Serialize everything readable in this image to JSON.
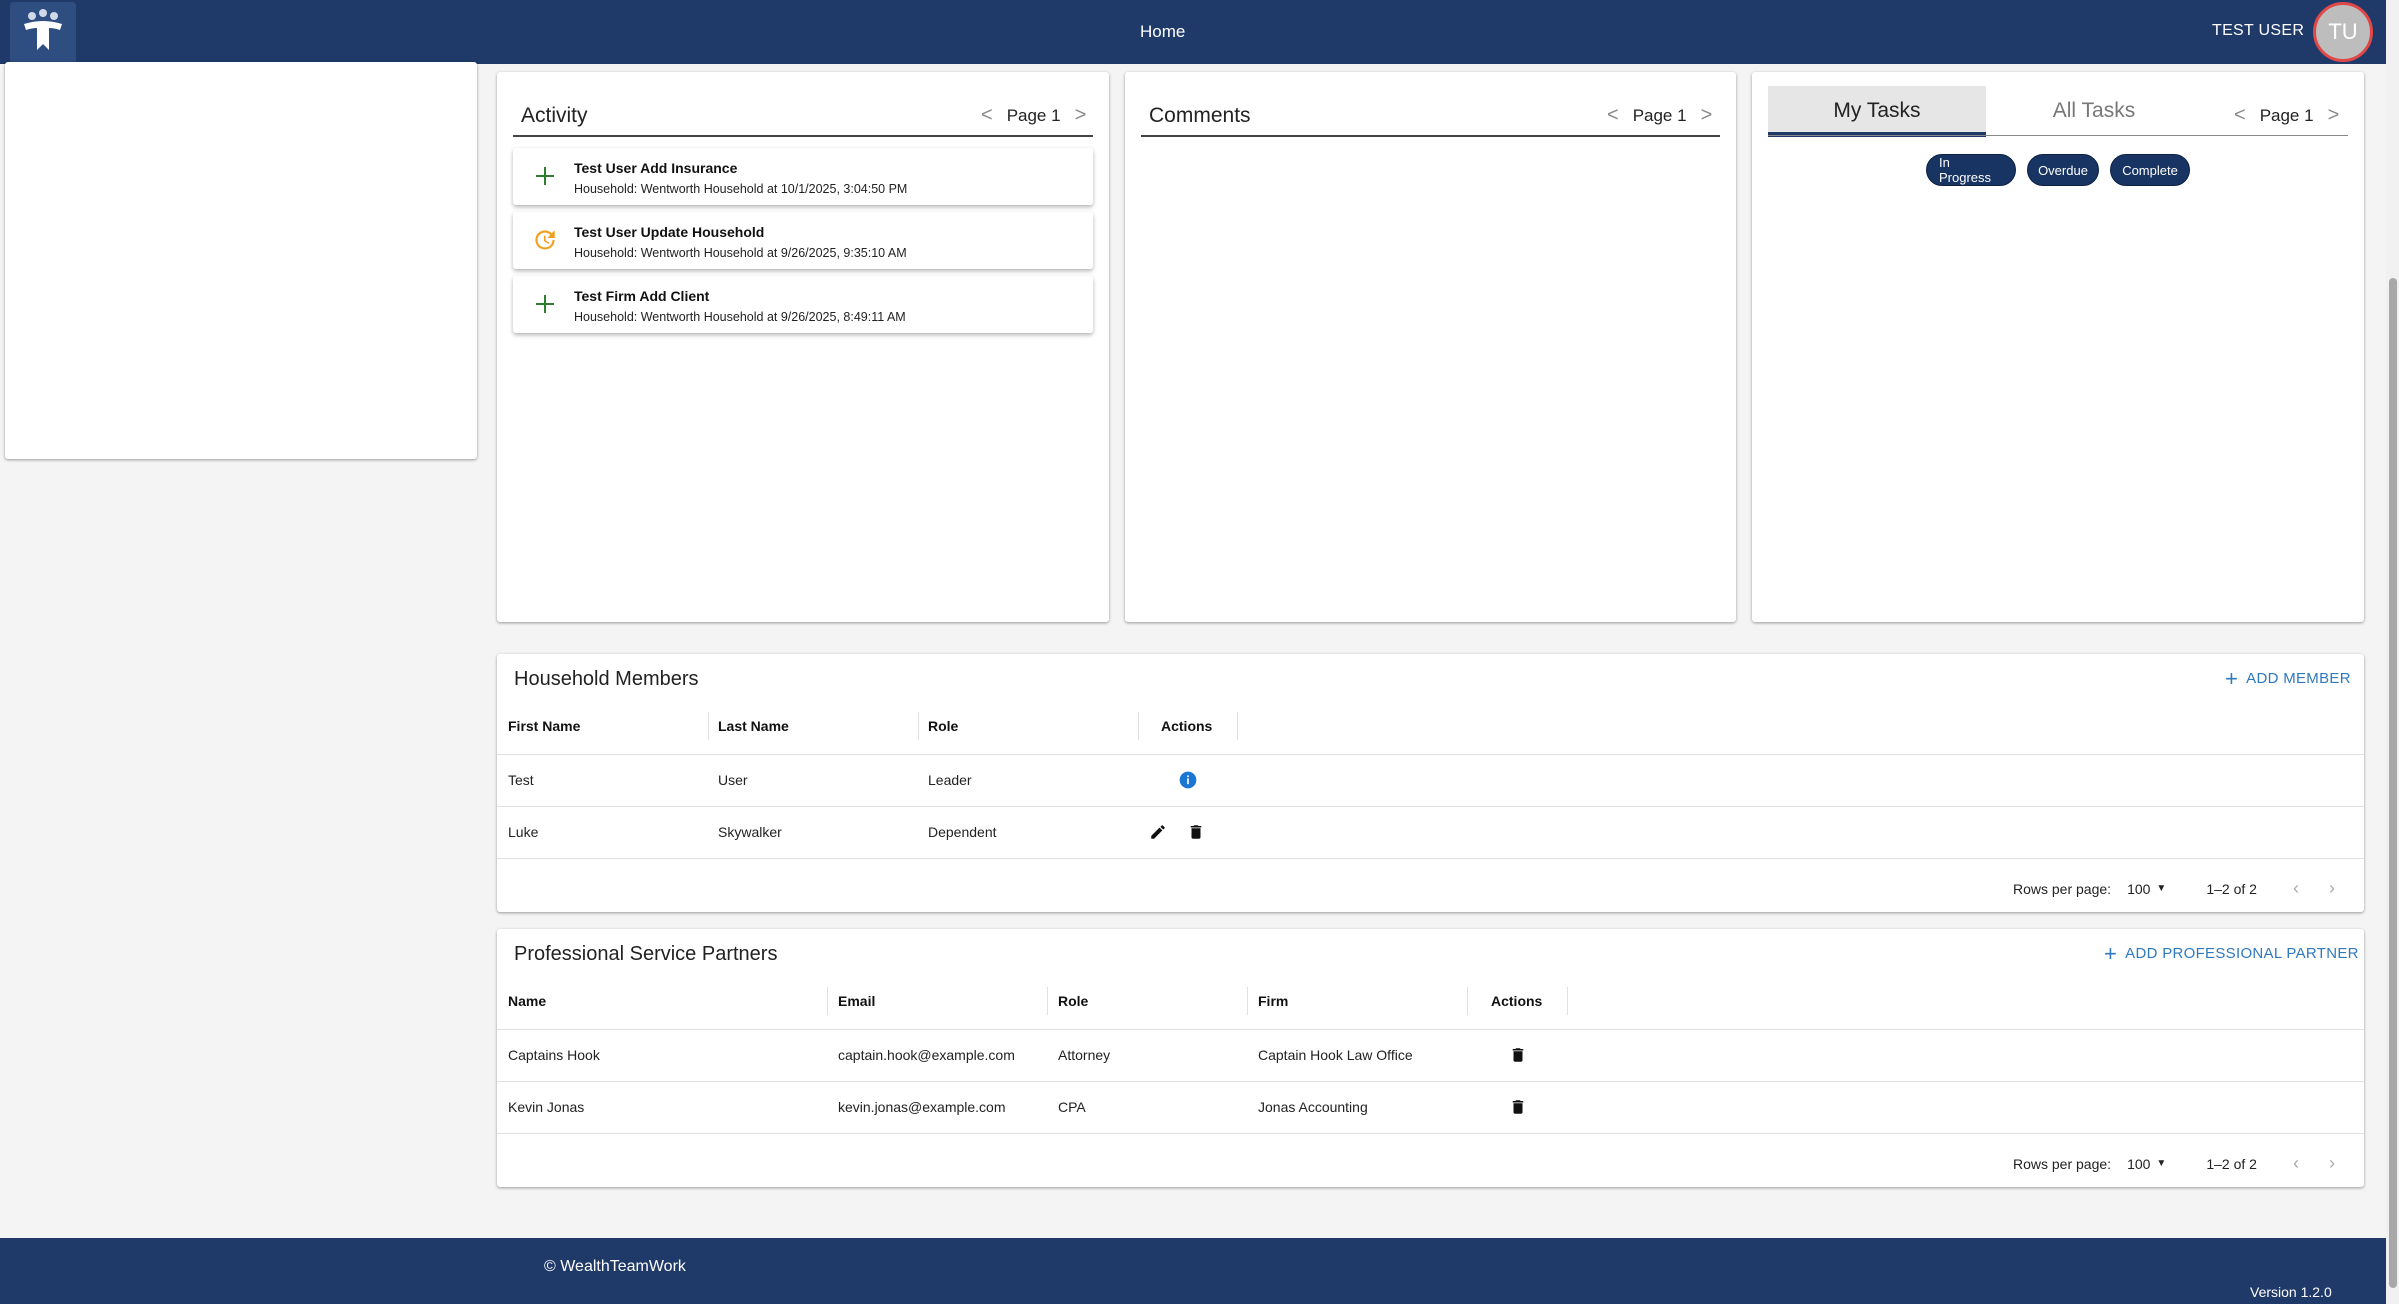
{
  "header": {
    "nav_home": "Home",
    "user_name": "TEST USER",
    "avatar_initials": "TU"
  },
  "activity": {
    "title": "Activity",
    "page_label": "Page 1",
    "items": [
      {
        "icon": "plus-icon",
        "title": "Test User Add Insurance",
        "subtitle": "Household: Wentworth Household at 10/1/2025, 3:04:50 PM"
      },
      {
        "icon": "update-icon",
        "title": "Test User Update Household",
        "subtitle": "Household: Wentworth Household at 9/26/2025, 9:35:10 AM"
      },
      {
        "icon": "plus-icon",
        "title": "Test Firm Add Client",
        "subtitle": "Household: Wentworth Household at 9/26/2025, 8:49:11 AM"
      }
    ]
  },
  "comments": {
    "title": "Comments",
    "page_label": "Page 1"
  },
  "tasks": {
    "tab_my": "My Tasks",
    "tab_all": "All Tasks",
    "page_label": "Page 1",
    "chips": [
      "In Progress",
      "Overdue",
      "Complete"
    ]
  },
  "members": {
    "title": "Household Members",
    "add_label": "ADD MEMBER",
    "columns": [
      "First Name",
      "Last Name",
      "Role",
      "Actions"
    ],
    "rows": [
      {
        "first": "Test",
        "last": "User",
        "role": "Leader"
      },
      {
        "first": "Luke",
        "last": "Skywalker",
        "role": "Dependent"
      }
    ],
    "rows_per_page_label": "Rows per page:",
    "rows_per_page": "100",
    "range": "1–2 of 2"
  },
  "partners": {
    "title": "Professional Service Partners",
    "add_label": "ADD PROFESSIONAL PARTNER",
    "columns": [
      "Name",
      "Email",
      "Role",
      "Firm",
      "Actions"
    ],
    "rows": [
      {
        "name": "Captains Hook",
        "email": "captain.hook@example.com",
        "role": "Attorney",
        "firm": "Captain Hook Law Office"
      },
      {
        "name": "Kevin Jonas",
        "email": "kevin.jonas@example.com",
        "role": "CPA",
        "firm": "Jonas Accounting"
      }
    ],
    "rows_per_page_label": "Rows per page:",
    "rows_per_page": "100",
    "range": "1–2 of 2"
  },
  "footer": {
    "copyright": "© WealthTeamWork",
    "version": "Version 1.2.0"
  },
  "colors": {
    "brand": "#1f3a68",
    "accent_link": "#2f79c0",
    "add_icon_green": "#2e7d32",
    "update_icon_orange": "#f0a020",
    "info_icon_blue": "#1976d2"
  }
}
